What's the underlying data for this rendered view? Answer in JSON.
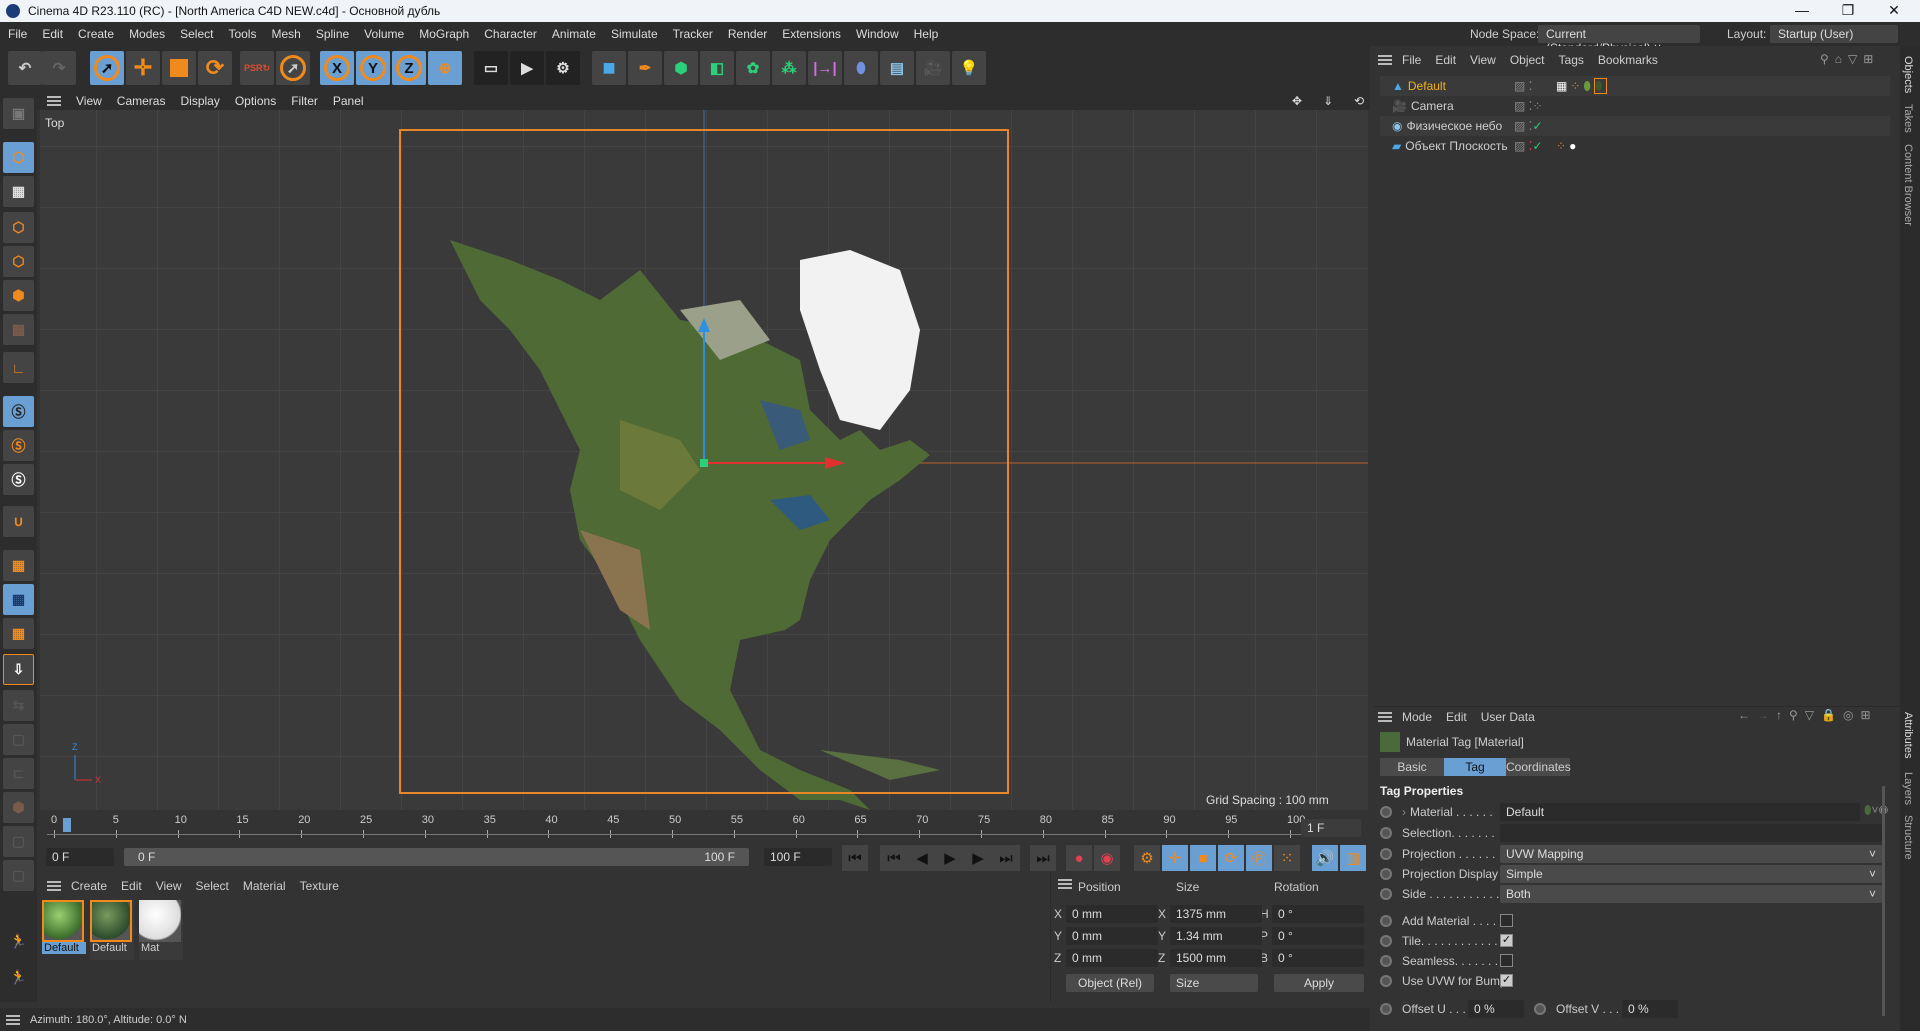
{
  "window": {
    "title": "Cinema 4D R23.110 (RC) - [North America C4D NEW.c4d] - Основной дубль",
    "minimize": "—",
    "maximize": "❐",
    "close": "✕"
  },
  "menu": [
    "File",
    "Edit",
    "Create",
    "Modes",
    "Select",
    "Tools",
    "Mesh",
    "Spline",
    "Volume",
    "MoGraph",
    "Character",
    "Animate",
    "Simulate",
    "Tracker",
    "Render",
    "Extensions",
    "Window",
    "Help"
  ],
  "node_space": {
    "label": "Node Space:",
    "value": "Current (Standard/Physical)"
  },
  "layout": {
    "label": "Layout:",
    "value": "Startup (User)"
  },
  "viewport": {
    "menu": [
      "View",
      "Cameras",
      "Display",
      "Options",
      "Filter",
      "Panel"
    ],
    "camera_label": "Top",
    "grid_spacing": "Grid Spacing : 100 mm",
    "axis_z": "Z",
    "axis_x": "X"
  },
  "object_manager": {
    "menu": [
      "File",
      "Edit",
      "View",
      "Object",
      "Tags",
      "Bookmarks"
    ],
    "objects": [
      {
        "name": "Default",
        "color": "#f0b020"
      },
      {
        "name": "Camera",
        "color": "#ddd"
      },
      {
        "name": "Физическое небо",
        "color": "#ddd"
      },
      {
        "name": "Объект Плоскость",
        "color": "#ddd"
      }
    ]
  },
  "side_tabs": {
    "objects": "Objects",
    "takes": "Takes",
    "content_browser": "Content Browser",
    "attributes": "Attributes",
    "layers": "Layers",
    "structure": "Structure"
  },
  "attributes": {
    "menu": [
      "Mode",
      "Edit",
      "User Data"
    ],
    "header": "Material Tag [Material]",
    "tabs": [
      "Basic",
      "Tag",
      "Coordinates"
    ],
    "active_tab": "Tag",
    "section": "Tag Properties",
    "material_label": "Material . . . . . .",
    "material": "Default",
    "selection_label": "Selection. . . . . . .",
    "selection": "",
    "projection_label": "Projection . . . . . .",
    "projection": "UVW Mapping",
    "projection_display_label": "Projection Display",
    "projection_display": "Simple",
    "side_label": "Side . . . . . . . . . . .",
    "side": "Both",
    "add_material_label": "Add Material . . . .",
    "add_material": false,
    "tile_label": "Tile. . . . . . . . . . . .",
    "tile": true,
    "seamless_label": "Seamless. . . . . . .",
    "seamless": false,
    "uvw_bump_label": "Use UVW for Bump",
    "uvw_bump": true,
    "offset_u_label": "Offset U . . .",
    "offset_u": "0 %",
    "offset_v_label": "Offset V . . .",
    "offset_v": "0 %"
  },
  "timeline": {
    "ticks": [
      "0",
      "5",
      "10",
      "15",
      "20",
      "25",
      "30",
      "35",
      "40",
      "45",
      "50",
      "55",
      "60",
      "65",
      "70",
      "75",
      "80",
      "85",
      "90",
      "95",
      "100"
    ],
    "current_frame_marker": "1",
    "frame_field": "1 F",
    "start": "0 F",
    "range_start": "0 F",
    "range_end": "100 F",
    "end": "100 F"
  },
  "material_manager": {
    "menu": [
      "Create",
      "Edit",
      "View",
      "Select",
      "Material",
      "Texture"
    ],
    "materials": [
      {
        "name": "Default",
        "selected": true
      },
      {
        "name": "Default",
        "selected": false
      },
      {
        "name": "Mat",
        "selected": false
      }
    ]
  },
  "coordinates": {
    "headers": [
      "Position",
      "Size",
      "Rotation"
    ],
    "rows": [
      {
        "pl": "X",
        "p": "0 mm",
        "sl": "X",
        "s": "1375 mm",
        "rl": "H",
        "r": "0 °"
      },
      {
        "pl": "Y",
        "p": "0 mm",
        "sl": "Y",
        "s": "1.34 mm",
        "rl": "P",
        "r": "0 °"
      },
      {
        "pl": "Z",
        "p": "0 mm",
        "sl": "Z",
        "s": "1500 mm",
        "rl": "B",
        "r": "0 °"
      }
    ],
    "mode": "Object (Rel)",
    "size_mode": "Size",
    "apply": "Apply"
  },
  "status": "Azimuth: 180.0°, Altitude: 0.0°  N"
}
